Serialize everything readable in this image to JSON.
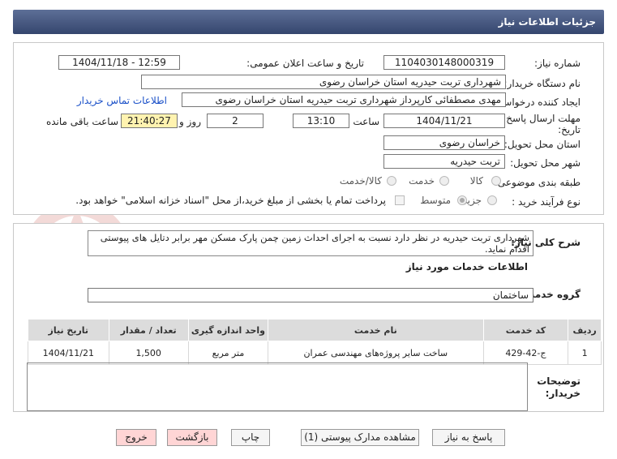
{
  "header": {
    "title": "جزئیات اطلاعات نیاز"
  },
  "fields": {
    "need_number_label": "شماره نیاز:",
    "need_number": "1104030148000319",
    "announce_label": "تاریخ و ساعت اعلان عمومی:",
    "announce_value": "1404/11/18 - 12:59",
    "buyer_org_label": "نام دستگاه خریدار:",
    "buyer_org": "شهرداری تربت حیدریه استان خراسان رضوی",
    "creator_label": "ایجاد کننده درخواست:",
    "creator": "مهدی مصطفائی کارپرداز شهرداری تربت حیدریه استان خراسان رضوی",
    "contact_link": "اطلاعات تماس خریدار",
    "deadline_label": "مهلت ارسال پاسخ: تا تاریخ:",
    "deadline_date": "1404/11/21",
    "time_label": "ساعت",
    "deadline_time": "13:10",
    "days_value": "2",
    "days_label": "روز و",
    "remaining_time": "21:40:27",
    "remaining_label": "ساعت باقی مانده",
    "province_label": "استان محل تحویل:",
    "province": "خراسان رضوی",
    "city_label": "شهر محل تحویل:",
    "city": "تربت حیدریه",
    "category_label": "طبقه بندی موضوعی:",
    "category_options": [
      "کالا",
      "خدمت",
      "کالا/خدمت"
    ],
    "process_label": "نوع فرآیند خرید :",
    "process_options": [
      "جزیی",
      "متوسط"
    ],
    "payment_text": "پرداخت تمام یا بخشی از مبلغ خرید،از محل \"اسناد خزانه اسلامی\" خواهد بود."
  },
  "description": {
    "label": "شرح کلی نیاز:",
    "text": "شهرداری تربت حیدریه در نظر دارد نسبت به اجرای احداث زمین چمن پارک مسکن مهر برابر دتایل های پیوستی اقدام نماید."
  },
  "services": {
    "section_title": "اطلاعات خدمات مورد نیاز",
    "group_label": "گروه خدمت:",
    "group_value": "ساختمان",
    "columns": [
      "ردیف",
      "کد خدمت",
      "نام خدمت",
      "واحد اندازه گیری",
      "تعداد / مقدار",
      "تاریخ نیاز"
    ],
    "rows": [
      {
        "row": "1",
        "code": "ج-42-429",
        "name": "ساخت سایر پروژه‌های مهندسی عمران",
        "unit": "متر مربع",
        "qty": "1,500",
        "date": "1404/11/21"
      }
    ]
  },
  "buyer_notes": {
    "label": "توضیحات خریدار:",
    "value": ""
  },
  "buttons": {
    "reply": "پاسخ به نیاز",
    "attachments": "مشاهده مدارک پیوستی (1)",
    "print": "چاپ",
    "back": "بازگشت",
    "exit": "خروج"
  }
}
